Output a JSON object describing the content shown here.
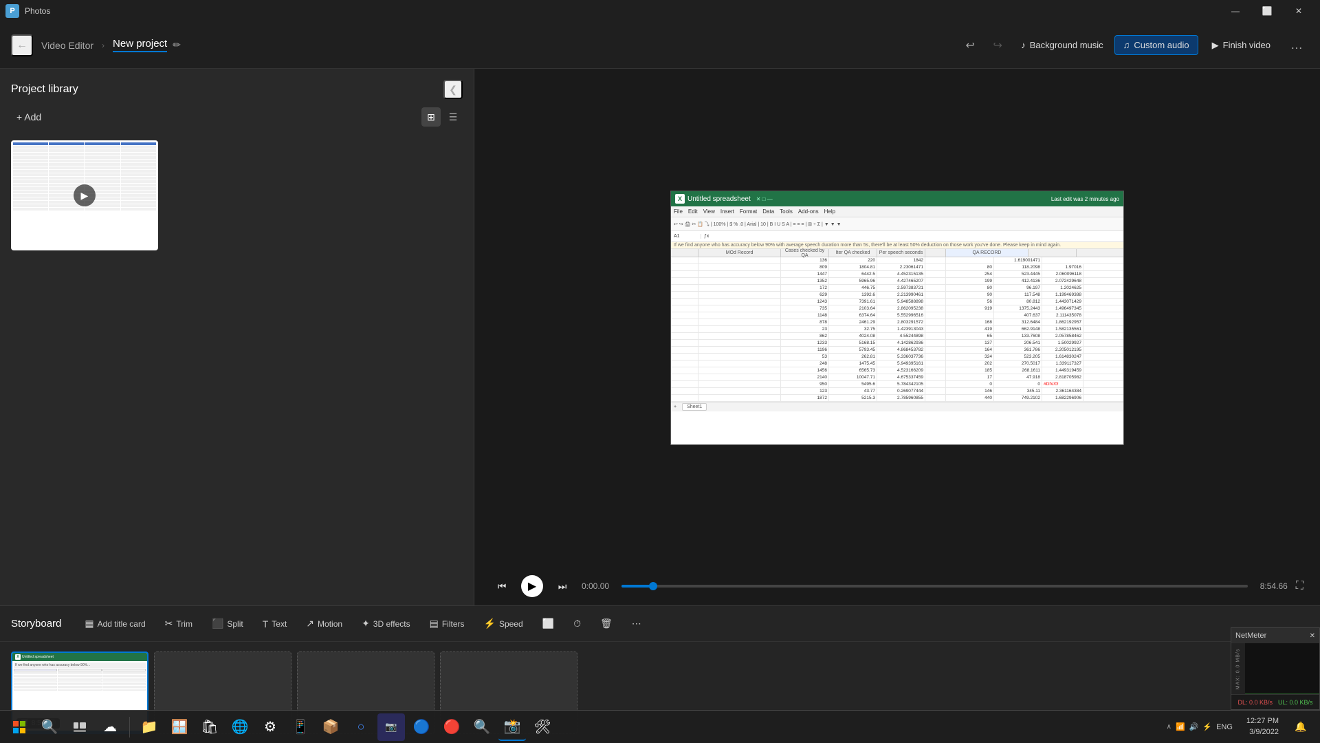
{
  "titlebar": {
    "app": "Photos",
    "back_icon": "←",
    "minimize_icon": "—",
    "maximize_icon": "⬜",
    "close_icon": "✕"
  },
  "toolbar": {
    "app_name": "Video Editor",
    "breadcrumb_separator": "›",
    "project_name": "New project",
    "edit_icon": "✏",
    "undo_icon": "↩",
    "redo_icon": "↪",
    "bg_music_icon": "♪",
    "bg_music_label": "Background music",
    "custom_audio_icon": "♫",
    "custom_audio_label": "Custom audio",
    "finish_icon": "▶",
    "finish_label": "Finish video",
    "more_icon": "…"
  },
  "project_library": {
    "title": "Project library",
    "add_label": "+ Add",
    "collapse_icon": "❮",
    "grid_icon": "⊞",
    "list_icon": "☰",
    "media_items": [
      {
        "type": "spreadsheet",
        "has_play": true
      }
    ]
  },
  "preview": {
    "spreadsheet": {
      "title": "Untitled spreadsheet",
      "subtitle": "Last edit was 2 minutes ago",
      "menus": [
        "File",
        "Edit",
        "View",
        "Insert",
        "Format",
        "Data",
        "Tools",
        "Add-ons",
        "Help"
      ],
      "notice": "If we find anyone who has accuracy below 90% with average speech duration more than 5s, there'll be at least 50% deduction on those work you've done. Please keep in mind again.",
      "section_headers": [
        "MOd Record",
        "QA RECORD"
      ],
      "columns": [
        "Cases checked by QA",
        "Iter QA checked",
        "Per speech seconds",
        "",
        "",
        "",
        "",
        "",
        ""
      ],
      "rows": [
        [
          "136",
          "220",
          "1842",
          "1.619001471"
        ],
        [
          "809",
          "1804.81",
          "2.23061471",
          "",
          "80",
          "118.2098",
          "1.97016"
        ],
        [
          "1447",
          "6442.5",
          "4.452315135",
          "",
          "254",
          "523.4445",
          "2.060096118"
        ],
        [
          "1352",
          "5965.96",
          "4.427465207",
          "",
          "199",
          "412.4136",
          "2.072429648"
        ],
        [
          "172",
          "446.75",
          "2.597383721",
          "",
          "80",
          "96.197",
          "1.2024625"
        ],
        [
          "629",
          "1392.6",
          "2.213990461",
          "",
          "90",
          "117.548",
          "1.199469388"
        ],
        [
          "1243",
          "7391.61",
          "5.948588898",
          "",
          "56",
          "80.812",
          "1.443071429"
        ],
        [
          "735",
          "2103.64",
          "2.862095238",
          "",
          "919",
          "1375.2443",
          "1.496497345"
        ],
        [
          "1148",
          "6374.64",
          "5.552996516",
          "",
          "407.637",
          "2.111435078"
        ],
        [
          "878",
          "2461.29",
          "2.803291572",
          "",
          "168",
          "312.6484",
          "1.862192957"
        ],
        [
          "23",
          "32.75",
          "1.423913043",
          "",
          "419",
          "662.9148",
          "1.582135561"
        ],
        [
          "862",
          "4024.08",
          "4.55244898",
          "",
          "65",
          "133.7608",
          "2.057858462"
        ],
        [
          "1233",
          "5168.15",
          "4.142862936",
          "",
          "137",
          "206.541",
          "1.50029927"
        ],
        [
          "1196",
          "5793.45",
          "4.868453782",
          "",
          "164",
          "361.786",
          "2.205012195"
        ],
        [
          "53",
          "262.81",
          "5.336037736",
          "",
          "324",
          "523.205",
          "1.614830247"
        ],
        [
          "248",
          "1475.45",
          "5.949395161",
          "",
          "202",
          "270.5017",
          "1.339117327"
        ],
        [
          "1456",
          "6565.73",
          "4.523166209",
          "",
          "185",
          "268.1611",
          "1.449319459"
        ],
        [
          "2140",
          "10047.71",
          "4.675337459",
          "",
          "17",
          "47.918",
          "2.818705982"
        ],
        [
          "950",
          "5495.6",
          "5.784342105",
          "",
          "0",
          "0",
          "#DIV/0!"
        ],
        [
          "123",
          "43.77",
          "0.269077444",
          "",
          "146",
          "345.11",
          "2.361164384"
        ],
        [
          "1872",
          "5215.3",
          "2.785960855",
          "",
          "440",
          "749.2102",
          "1.682296906"
        ]
      ]
    },
    "playback": {
      "rewind_icon": "⏮",
      "play_icon": "▶",
      "fast_forward_icon": "⏭",
      "current_time": "0:00.00",
      "total_time": "8:54.66",
      "progress_pct": 2,
      "fullscreen_icon": "⛶"
    }
  },
  "storyboard": {
    "title": "Storyboard",
    "tools": [
      {
        "id": "add-title-card",
        "icon": "▦",
        "label": "Add title card"
      },
      {
        "id": "trim",
        "icon": "✂",
        "label": "Trim"
      },
      {
        "id": "split",
        "icon": "⬛",
        "label": "Split"
      },
      {
        "id": "text",
        "icon": "T",
        "label": "Text"
      },
      {
        "id": "motion",
        "icon": "↗",
        "label": "Motion"
      },
      {
        "id": "3d-effects",
        "icon": "✦",
        "label": "3D effects"
      },
      {
        "id": "filters",
        "icon": "▤",
        "label": "Filters"
      },
      {
        "id": "speed",
        "icon": "⚡",
        "label": "Speed"
      },
      {
        "id": "crop",
        "icon": "⬜",
        "label": ""
      },
      {
        "id": "timer",
        "icon": "⏱",
        "label": ""
      },
      {
        "id": "delete",
        "icon": "🗑",
        "label": ""
      },
      {
        "id": "more2",
        "icon": "⋯",
        "label": ""
      }
    ],
    "items": [
      {
        "type": "video",
        "duration": "8:54",
        "has_audio": true,
        "active": true
      },
      {
        "type": "empty"
      },
      {
        "type": "empty"
      },
      {
        "type": "empty"
      }
    ]
  },
  "netmeter": {
    "title": "NetMeter",
    "close_icon": "✕",
    "dl_label": "DL: 0.0 KB/s",
    "ul_label": "UL: 0.0 KB/s",
    "y_label": "MAX: 0.0 MB/s"
  },
  "taskbar": {
    "start_icon": "⊞",
    "search_icon": "🔍",
    "task_icon": "⊞",
    "widgets_icon": "☁",
    "clock": {
      "time": "12:27 PM",
      "date": "3/9/2022"
    },
    "apps": [
      "📁",
      "🪟",
      "🎮",
      "🌐",
      "⚙",
      "📋",
      "🗂",
      "🎵",
      "💻",
      "🔒",
      "🌐",
      "🔬",
      "📷",
      "🛡"
    ]
  }
}
